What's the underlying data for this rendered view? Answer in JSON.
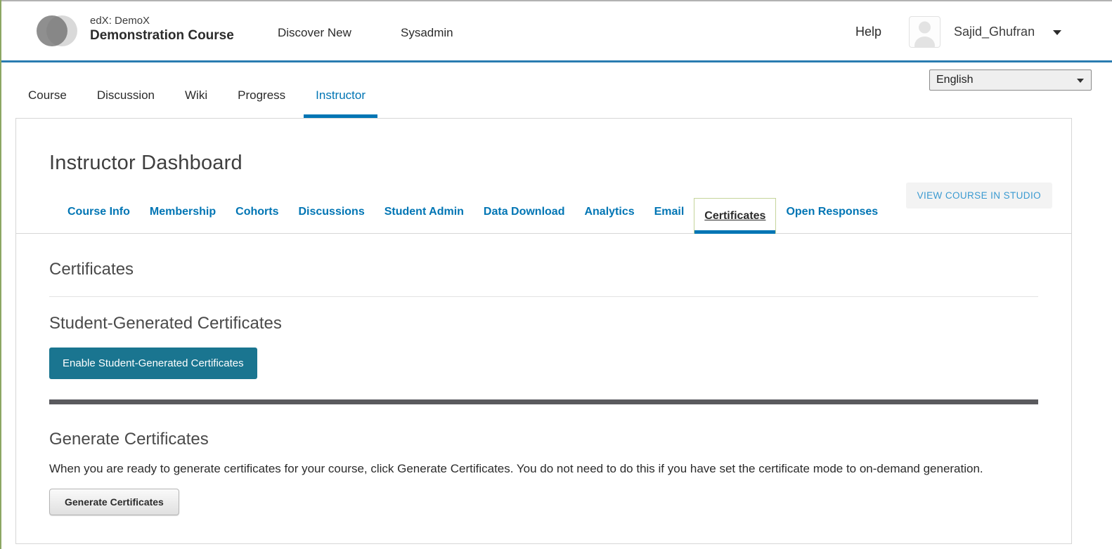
{
  "header": {
    "org": "edX: DemoX",
    "course_title": "Demonstration Course",
    "nav": {
      "discover": "Discover New",
      "sysadmin": "Sysadmin"
    },
    "help_label": "Help",
    "username": "Sajid_Ghufran"
  },
  "language_select": {
    "value": "English"
  },
  "course_nav": {
    "tabs": [
      "Course",
      "Discussion",
      "Wiki",
      "Progress",
      "Instructor"
    ],
    "active": "Instructor"
  },
  "dashboard": {
    "title": "Instructor Dashboard",
    "studio_button": "VIEW COURSE IN STUDIO",
    "tabs": [
      "Course Info",
      "Membership",
      "Cohorts",
      "Discussions",
      "Student Admin",
      "Data Download",
      "Analytics",
      "Email",
      "Certificates",
      "Open Responses"
    ],
    "active_tab": "Certificates"
  },
  "certificates": {
    "heading": "Certificates",
    "student_generated": {
      "heading": "Student-Generated Certificates",
      "enable_button": "Enable Student-Generated Certificates"
    },
    "generate": {
      "heading": "Generate Certificates",
      "description": "When you are ready to generate certificates for your course, click Generate Certificates. You do not need to do this if you have set the certificate mode to on-demand generation.",
      "button": "Generate Certificates"
    }
  },
  "colors": {
    "accent_blue": "#0075b4",
    "header_rule_blue": "#2a7cb1",
    "teal_button": "#1a7590",
    "active_tab_border": "#c5d49b",
    "dark_divider": "#5a5a5e",
    "window_edge_green": "#8ca763"
  }
}
